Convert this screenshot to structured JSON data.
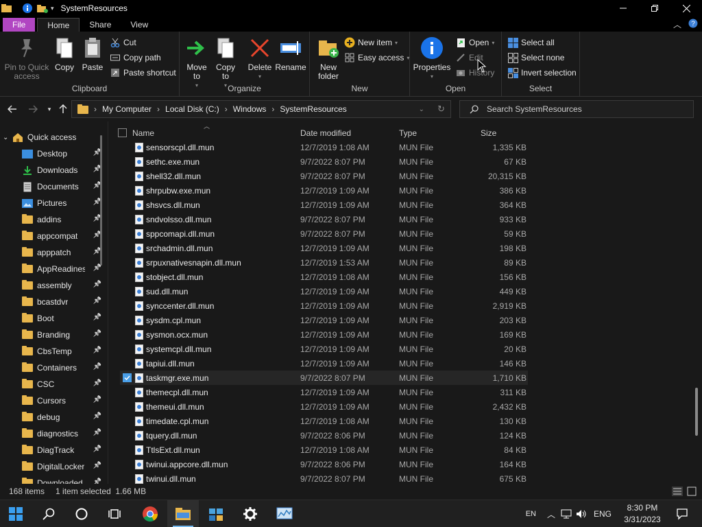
{
  "window": {
    "title": "SystemResources",
    "controls": [
      "minimize",
      "maximize",
      "close"
    ]
  },
  "tabs": [
    "File",
    "Home",
    "Share",
    "View"
  ],
  "ribbon": {
    "clipboard": {
      "label": "Clipboard",
      "pin": "Pin to Quick access",
      "copy": "Copy",
      "paste": "Paste",
      "cut": "Cut",
      "copy_path": "Copy path",
      "paste_shortcut": "Paste shortcut"
    },
    "organize": {
      "label": "Organize",
      "move_to": "Move to",
      "copy_to": "Copy to",
      "delete": "Delete",
      "rename": "Rename"
    },
    "new": {
      "label": "New",
      "new_folder": "New folder",
      "new_item": "New item",
      "easy_access": "Easy access"
    },
    "open": {
      "label": "Open",
      "properties": "Properties",
      "open": "Open",
      "edit": "Edit",
      "history": "History"
    },
    "select": {
      "label": "Select",
      "select_all": "Select all",
      "select_none": "Select none",
      "invert_selection": "Invert selection"
    }
  },
  "address": {
    "crumbs": [
      "My Computer",
      "Local Disk (C:)",
      "Windows",
      "SystemResources"
    ],
    "search_placeholder": "Search SystemResources"
  },
  "navpane": {
    "items": [
      {
        "label": "Quick access",
        "icon": "star-icon"
      },
      {
        "label": "Desktop",
        "icon": "desktop-icon"
      },
      {
        "label": "Downloads",
        "icon": "download-icon"
      },
      {
        "label": "Documents",
        "icon": "documents-icon"
      },
      {
        "label": "Pictures",
        "icon": "pictures-icon"
      },
      {
        "label": "addins",
        "icon": "folder-icon"
      },
      {
        "label": "appcompat",
        "icon": "folder-icon"
      },
      {
        "label": "apppatch",
        "icon": "folder-icon"
      },
      {
        "label": "AppReadiness",
        "icon": "folder-icon"
      },
      {
        "label": "assembly",
        "icon": "folder-icon"
      },
      {
        "label": "bcastdvr",
        "icon": "folder-icon"
      },
      {
        "label": "Boot",
        "icon": "folder-icon"
      },
      {
        "label": "Branding",
        "icon": "folder-icon"
      },
      {
        "label": "CbsTemp",
        "icon": "folder-icon"
      },
      {
        "label": "Containers",
        "icon": "folder-icon"
      },
      {
        "label": "CSC",
        "icon": "folder-icon"
      },
      {
        "label": "Cursors",
        "icon": "folder-icon"
      },
      {
        "label": "debug",
        "icon": "folder-icon"
      },
      {
        "label": "diagnostics",
        "icon": "folder-icon"
      },
      {
        "label": "DiagTrack",
        "icon": "folder-icon"
      },
      {
        "label": "DigitalLocker",
        "icon": "folder-icon"
      },
      {
        "label": "Downloaded",
        "icon": "folder-icon"
      }
    ]
  },
  "columns": {
    "name": "Name",
    "date": "Date modified",
    "type": "Type",
    "size": "Size"
  },
  "files": [
    {
      "name": "sensorscpl.dll.mun",
      "date": "12/7/2019 1:08 AM",
      "type": "MUN File",
      "size": "1,335 KB"
    },
    {
      "name": "sethc.exe.mun",
      "date": "9/7/2022 8:07 PM",
      "type": "MUN File",
      "size": "67 KB"
    },
    {
      "name": "shell32.dll.mun",
      "date": "9/7/2022 8:07 PM",
      "type": "MUN File",
      "size": "20,315 KB"
    },
    {
      "name": "shrpubw.exe.mun",
      "date": "12/7/2019 1:09 AM",
      "type": "MUN File",
      "size": "386 KB"
    },
    {
      "name": "shsvcs.dll.mun",
      "date": "12/7/2019 1:09 AM",
      "type": "MUN File",
      "size": "364 KB"
    },
    {
      "name": "sndvolsso.dll.mun",
      "date": "9/7/2022 8:07 PM",
      "type": "MUN File",
      "size": "933 KB"
    },
    {
      "name": "sppcomapi.dll.mun",
      "date": "9/7/2022 8:07 PM",
      "type": "MUN File",
      "size": "59 KB"
    },
    {
      "name": "srchadmin.dll.mun",
      "date": "12/7/2019 1:09 AM",
      "type": "MUN File",
      "size": "198 KB"
    },
    {
      "name": "srpuxnativesnapin.dll.mun",
      "date": "12/7/2019 1:53 AM",
      "type": "MUN File",
      "size": "89 KB"
    },
    {
      "name": "stobject.dll.mun",
      "date": "12/7/2019 1:08 AM",
      "type": "MUN File",
      "size": "156 KB"
    },
    {
      "name": "sud.dll.mun",
      "date": "12/7/2019 1:09 AM",
      "type": "MUN File",
      "size": "449 KB"
    },
    {
      "name": "synccenter.dll.mun",
      "date": "12/7/2019 1:09 AM",
      "type": "MUN File",
      "size": "2,919 KB"
    },
    {
      "name": "sysdm.cpl.mun",
      "date": "12/7/2019 1:09 AM",
      "type": "MUN File",
      "size": "203 KB"
    },
    {
      "name": "sysmon.ocx.mun",
      "date": "12/7/2019 1:09 AM",
      "type": "MUN File",
      "size": "169 KB"
    },
    {
      "name": "systemcpl.dll.mun",
      "date": "12/7/2019 1:09 AM",
      "type": "MUN File",
      "size": "20 KB"
    },
    {
      "name": "tapiui.dll.mun",
      "date": "12/7/2019 1:09 AM",
      "type": "MUN File",
      "size": "146 KB"
    },
    {
      "name": "taskmgr.exe.mun",
      "date": "9/7/2022 8:07 PM",
      "type": "MUN File",
      "size": "1,710 KB",
      "selected": true
    },
    {
      "name": "themecpl.dll.mun",
      "date": "12/7/2019 1:09 AM",
      "type": "MUN File",
      "size": "311 KB"
    },
    {
      "name": "themeui.dll.mun",
      "date": "12/7/2019 1:09 AM",
      "type": "MUN File",
      "size": "2,432 KB"
    },
    {
      "name": "timedate.cpl.mun",
      "date": "12/7/2019 1:08 AM",
      "type": "MUN File",
      "size": "130 KB"
    },
    {
      "name": "tquery.dll.mun",
      "date": "9/7/2022 8:06 PM",
      "type": "MUN File",
      "size": "124 KB"
    },
    {
      "name": "TtlsExt.dll.mun",
      "date": "12/7/2019 1:08 AM",
      "type": "MUN File",
      "size": "84 KB"
    },
    {
      "name": "twinui.appcore.dll.mun",
      "date": "9/7/2022 8:06 PM",
      "type": "MUN File",
      "size": "164 KB"
    },
    {
      "name": "twinui.dll.mun",
      "date": "9/7/2022 8:07 PM",
      "type": "MUN File",
      "size": "675 KB"
    }
  ],
  "status": {
    "count": "168 items",
    "selection": "1 item selected  1.66 MB"
  },
  "taskbar": {
    "lang_short": "EN",
    "lang": "ENG",
    "time": "8:30 PM",
    "date": "3/31/2023"
  },
  "colors": {
    "accent": "#b146c2",
    "selection": "#76b9ed",
    "folder": "#e8b64c"
  }
}
